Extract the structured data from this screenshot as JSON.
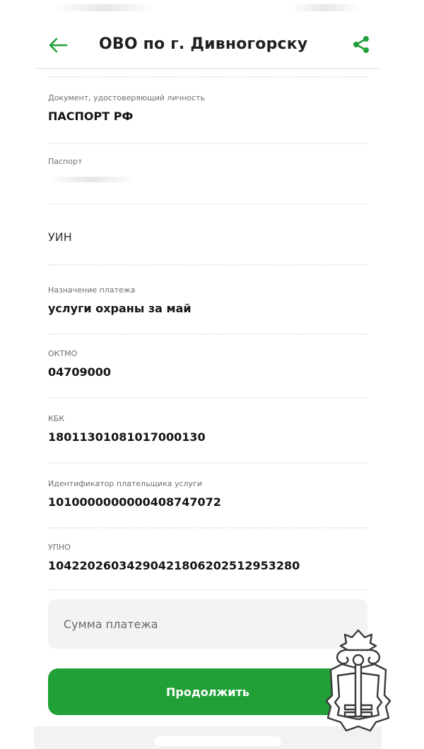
{
  "header": {
    "title": "ОВО по г. Дивногорску",
    "back_icon": "arrow-left-icon",
    "share_icon": "share-icon"
  },
  "fields": {
    "document": {
      "label": "Документ, удостоверяющий личность",
      "value": "ПАСПОРТ РФ"
    },
    "passport": {
      "label": "Паспорт"
    },
    "uin": {
      "label": "УИН"
    },
    "purpose": {
      "label": "Назначение платежа",
      "value": "услуги охраны за май"
    },
    "oktmo": {
      "label": "ОКТМО",
      "value": "04709000"
    },
    "kbk": {
      "label": "КБК",
      "value": "18011301081017000130"
    },
    "payer_id": {
      "label": "Идентификатор плательщика услуги",
      "value": "1010000000000408747072"
    },
    "upno": {
      "label": "УПНО",
      "value": "10422026034290421806202512953280"
    }
  },
  "amount": {
    "placeholder": "Сумма платежа"
  },
  "actions": {
    "continue_label": "Продолжить"
  },
  "colors": {
    "accent": "#21a038",
    "input_bg": "#f2f3f5"
  }
}
